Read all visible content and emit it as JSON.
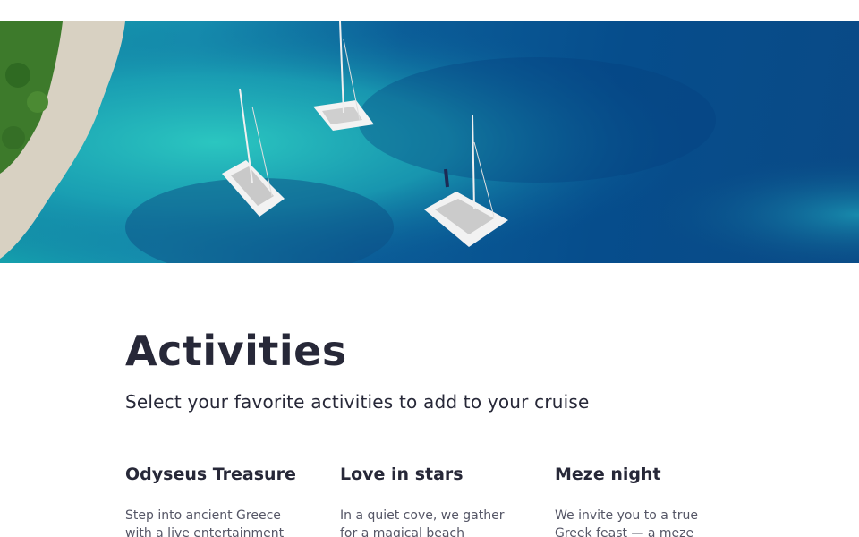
{
  "hero": {
    "image_alt": "Aerial view of three catamarans anchored in turquoise water near a rocky coastline",
    "colors": {
      "shallow_water": "#1fb5b8",
      "deep_water": "#0a4d8c",
      "shore": "#d9d2c4",
      "trees": "#3f7a2c"
    }
  },
  "activities": {
    "title": "Activities",
    "subtitle": "Select your favorite activities to add to your cruise",
    "cards": [
      {
        "title": "Odyseus Treasure",
        "description": "Step into ancient Greece with a live entertainment"
      },
      {
        "title": "Love in stars",
        "description": "In a quiet cove, we gather for a magical beach"
      },
      {
        "title": "Meze night",
        "description": "We invite you to a true Greek feast — a meze night"
      }
    ]
  }
}
